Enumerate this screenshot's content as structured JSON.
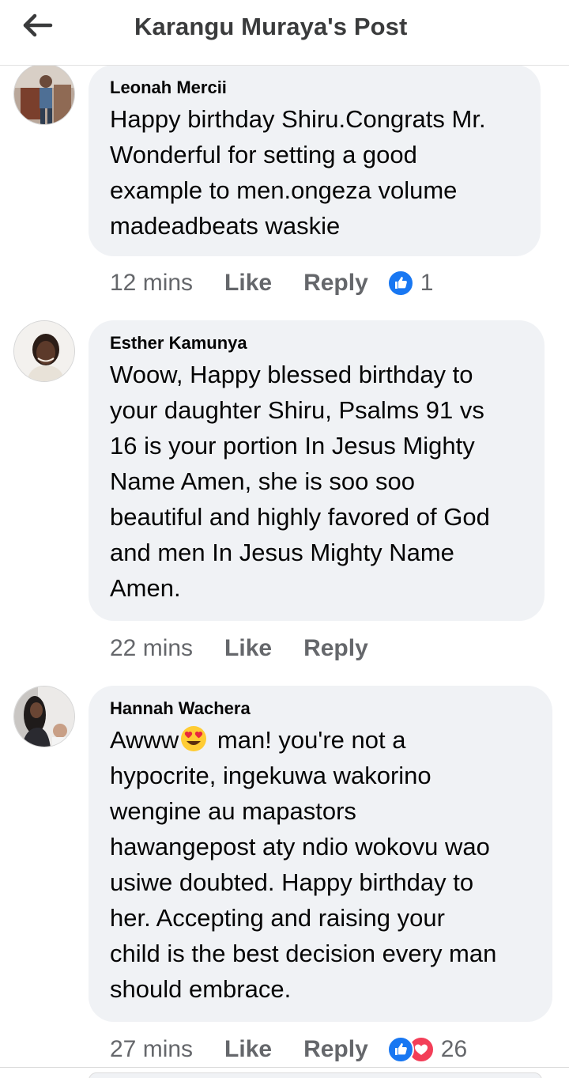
{
  "header": {
    "title": "Karangu Muraya's Post",
    "back_icon": "arrow-left-icon"
  },
  "comments": [
    {
      "author": "Leonah Mercii",
      "text": "Happy birthday Shiru.Congrats Mr.\nWonderful for setting a  good\nexample to men.ongeza volume\nmadeadbeats waskie",
      "time": "12 mins",
      "like_label": "Like",
      "reply_label": "Reply",
      "reaction_count": "1",
      "reactions": [
        "like-icon"
      ]
    },
    {
      "author": "Esther Kamunya",
      "text": "Woow, Happy blessed birthday to\nyour daughter Shiru, Psalms 91 vs\n16 is your portion In Jesus Mighty\nName Amen, she is soo soo\nbeautiful and highly favored of God\nand men In Jesus Mighty Name\nAmen.",
      "time": "22 mins",
      "like_label": "Like",
      "reply_label": "Reply"
    },
    {
      "author": "Hannah Wachera",
      "text_before_emoji": "Awww",
      "emoji": "heart-eyes-emoji",
      "text_after_emoji": " man! you're not a\nhypocrite, ingekuwa wakorino\nwengine au mapastors\nhawangepost aty ndio wokovu wao\nusiwe doubted. Happy birthday to\nher. Accepting and raising your\nchild is the best decision every man\nshould embrace.",
      "time": "27 mins",
      "like_label": "Like",
      "reply_label": "Reply",
      "reaction_count": "26",
      "reactions": [
        "like-icon",
        "love-icon"
      ]
    }
  ],
  "colors": {
    "bubble": "#f0f2f5",
    "meta_text": "#65676b",
    "like_blue": "#1877f2",
    "love_red": "#f33e58"
  }
}
